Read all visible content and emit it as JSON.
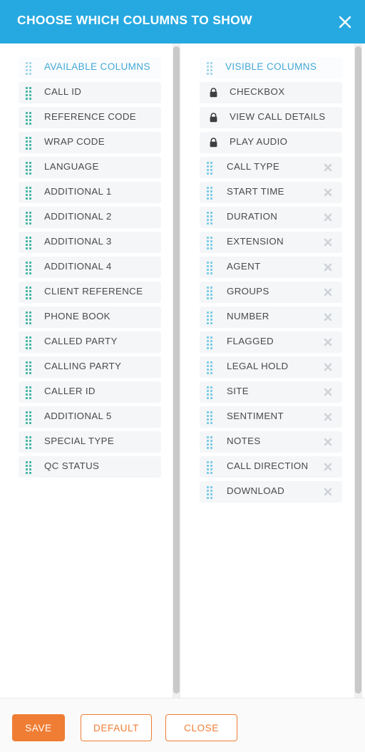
{
  "header": {
    "title": "CHOOSE WHICH COLUMNS TO SHOW",
    "close_icon": "close-icon",
    "background_color": "#26a9e0",
    "text_color": "#ffffff"
  },
  "panes": {
    "available": {
      "header_label": "AVAILABLE COLUMNS",
      "handle_icon": "drag-handle-icon",
      "items": [
        {
          "label": "CALL ID"
        },
        {
          "label": "REFERENCE CODE"
        },
        {
          "label": "WRAP CODE"
        },
        {
          "label": "LANGUAGE"
        },
        {
          "label": "ADDITIONAL 1"
        },
        {
          "label": "ADDITIONAL 2"
        },
        {
          "label": "ADDITIONAL 3"
        },
        {
          "label": "ADDITIONAL 4"
        },
        {
          "label": "CLIENT REFERENCE"
        },
        {
          "label": "PHONE BOOK"
        },
        {
          "label": "CALLED PARTY"
        },
        {
          "label": "CALLING PARTY"
        },
        {
          "label": "CALLER ID"
        },
        {
          "label": "ADDITIONAL 5"
        },
        {
          "label": "SPECIAL TYPE"
        },
        {
          "label": "QC STATUS"
        }
      ]
    },
    "visible": {
      "header_label": "VISIBLE COLUMNS",
      "handle_icon": "drag-handle-icon",
      "lock_icon": "lock-icon",
      "remove_icon": "remove-icon",
      "items": [
        {
          "label": "CHECKBOX",
          "locked": true
        },
        {
          "label": "VIEW CALL DETAILS",
          "locked": true
        },
        {
          "label": "PLAY AUDIO",
          "locked": true
        },
        {
          "label": "CALL TYPE",
          "locked": false
        },
        {
          "label": "START TIME",
          "locked": false
        },
        {
          "label": "DURATION",
          "locked": false
        },
        {
          "label": "EXTENSION",
          "locked": false
        },
        {
          "label": "AGENT",
          "locked": false
        },
        {
          "label": "GROUPS",
          "locked": false
        },
        {
          "label": "NUMBER",
          "locked": false
        },
        {
          "label": "FLAGGED",
          "locked": false
        },
        {
          "label": "LEGAL HOLD",
          "locked": false
        },
        {
          "label": "SITE",
          "locked": false
        },
        {
          "label": "SENTIMENT",
          "locked": false
        },
        {
          "label": "NOTES",
          "locked": false
        },
        {
          "label": "CALL DIRECTION",
          "locked": false
        },
        {
          "label": "DOWNLOAD",
          "locked": false
        }
      ]
    }
  },
  "scrollbars": [
    {
      "name": "available-columns-scrollbar",
      "thumb_top_pct": 0,
      "thumb_height_pct": 100
    },
    {
      "name": "visible-columns-scrollbar",
      "thumb_top_pct": 0,
      "thumb_height_pct": 100
    }
  ],
  "footer": {
    "save_label": "SAVE",
    "default_label": "DEFAULT",
    "close_label": "CLOSE",
    "accent_color": "#ef7d34"
  }
}
